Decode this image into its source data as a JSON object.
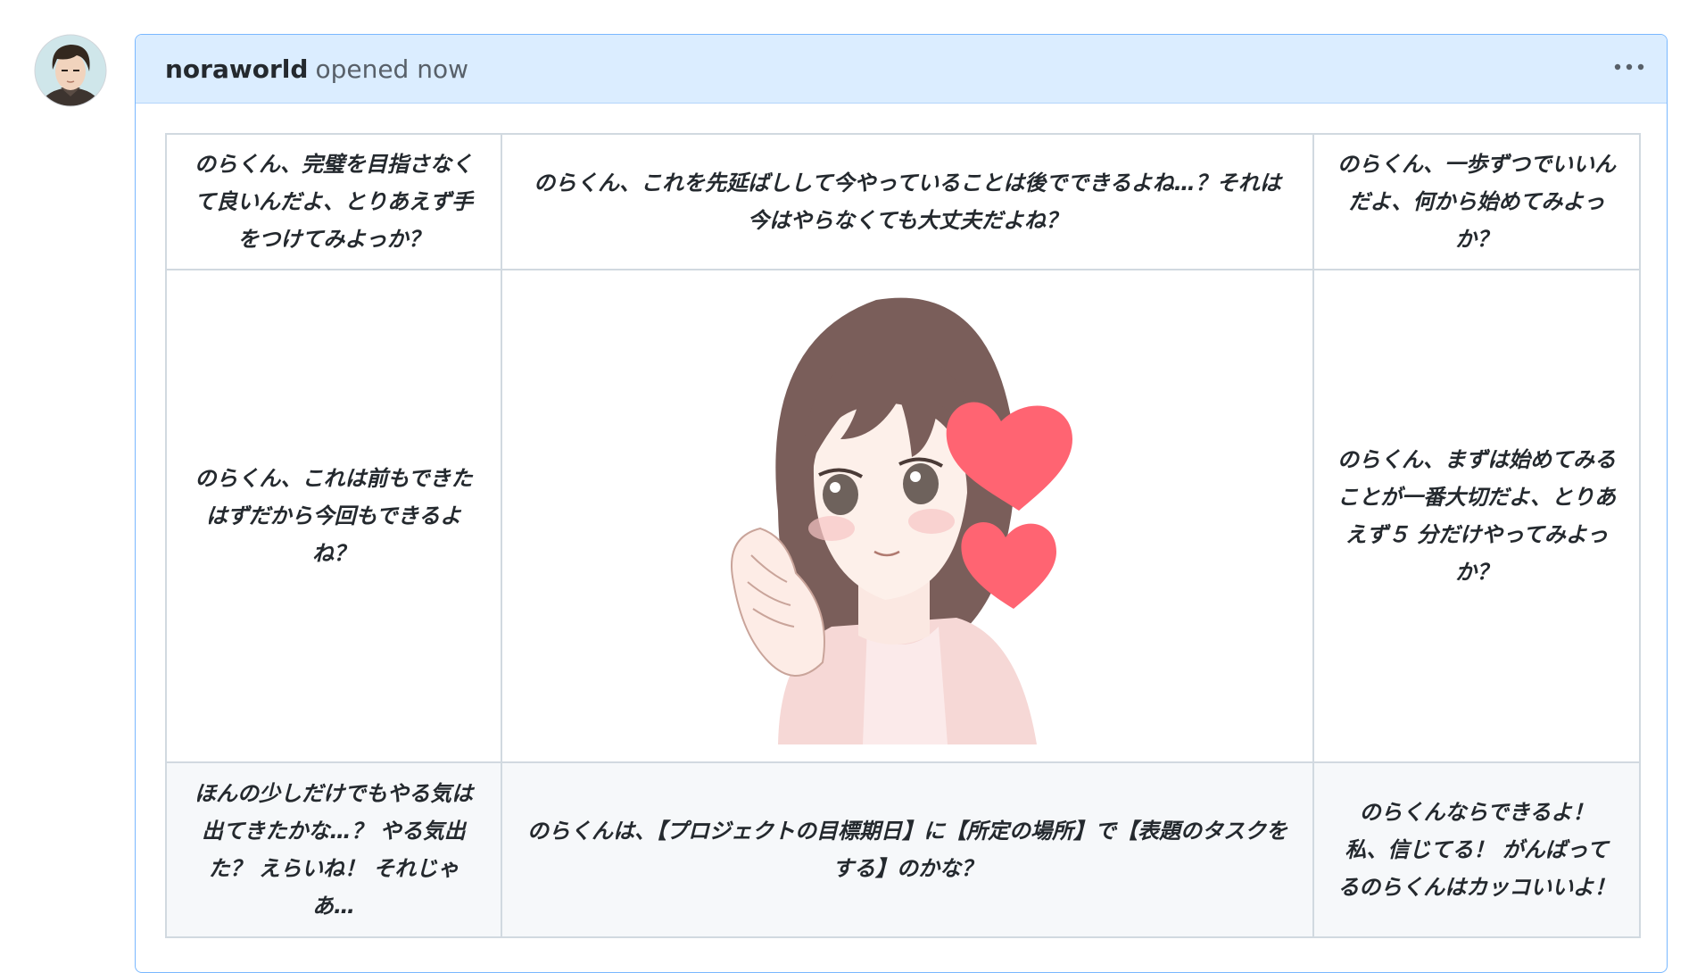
{
  "comment": {
    "author": "noraworld",
    "meta": "opened now",
    "menu_icon": "kebab-horizontal-icon"
  },
  "avatar": {
    "icon": "user-avatar"
  },
  "grid": {
    "rows": [
      [
        "のらくん、完璧を目指さなくて良いんだよ、とりあえず手をつけてみよっか？",
        "のらくん、これを先延ばしして今やっていることは後でできるよね…？それは今はやらなくても大丈夫だよね？",
        "のらくん、一歩ずつでいいんだよ、何から始めてみよっか？"
      ],
      [
        "のらくん、これは前もできたはずだから今回もできるよね？",
        "",
        "のらくん、まずは始めてみることが一番大切だよ、とりあえず５ 分だけやってみよっか？"
      ],
      [
        "ほんの少しだけでもやる気は出てきたかな…？ やる気出た？ えらいね！ それじゃあ…",
        "のらくんは、【プロジェクトの目標期日】に【所定の場所】で【表題のタスクをする】のかな？",
        "のらくんならできるよ！ 私、信じてる！ がんばってるのらくんはカッコいいよ！"
      ]
    ],
    "center_image": "girl-with-hearts-illustration"
  },
  "colors": {
    "header_bg": "#dbedff",
    "border": "#79b8ff",
    "heart": "#ff6472",
    "hair": "#7a5e5a"
  }
}
